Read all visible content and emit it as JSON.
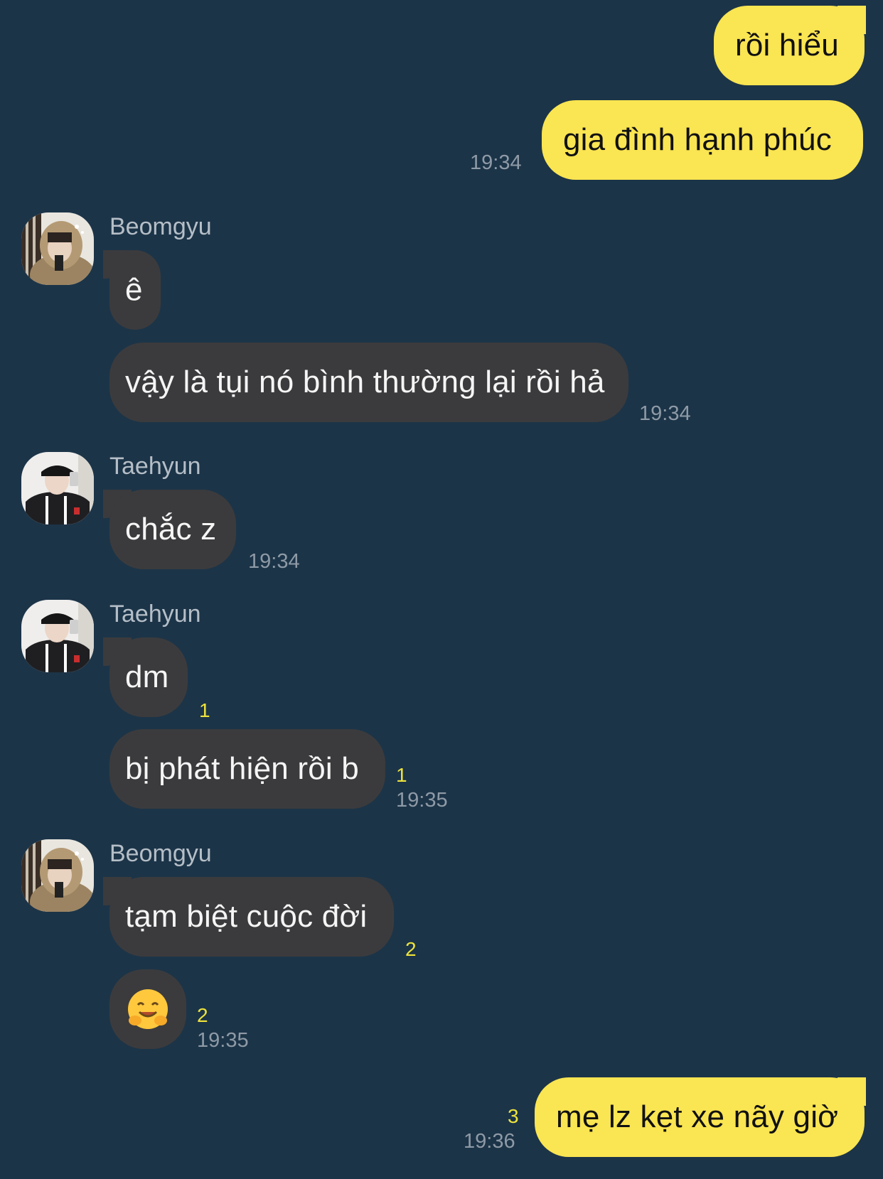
{
  "messages": {
    "m1": {
      "sender": "me",
      "text": "rồi hiểu"
    },
    "m2": {
      "sender": "me",
      "text": "gia đình hạnh phúc",
      "time": "19:34"
    },
    "m3": {
      "sender": "Beomgyu",
      "text": "ê"
    },
    "m4": {
      "sender": "Beomgyu",
      "text": "vậy là tụi nó bình thường lại rồi hả",
      "time": "19:34"
    },
    "m5": {
      "sender": "Taehyun",
      "text": "chắc z",
      "time": "19:34"
    },
    "m6": {
      "sender": "Taehyun",
      "text": "dm",
      "unread": "1"
    },
    "m7": {
      "sender": "Taehyun",
      "text": "bị phát hiện rồi b",
      "unread": "1",
      "time": "19:35"
    },
    "m8": {
      "sender": "Beomgyu",
      "text": "tạm biệt cuộc đời",
      "unread": "2"
    },
    "m9": {
      "sender": "Beomgyu",
      "emoji": "🤗",
      "unread": "2",
      "time": "19:35"
    },
    "m10": {
      "sender": "me",
      "text": "mẹ lz kẹt xe nãy giờ",
      "unread": "3",
      "time": "19:36"
    }
  },
  "names": {
    "beomgyu": "Beomgyu",
    "taehyun": "Taehyun"
  },
  "colors": {
    "background": "#1c3448",
    "my_bubble": "#fae552",
    "their_bubble": "#3b3b3d",
    "unread": "#ede33c"
  }
}
